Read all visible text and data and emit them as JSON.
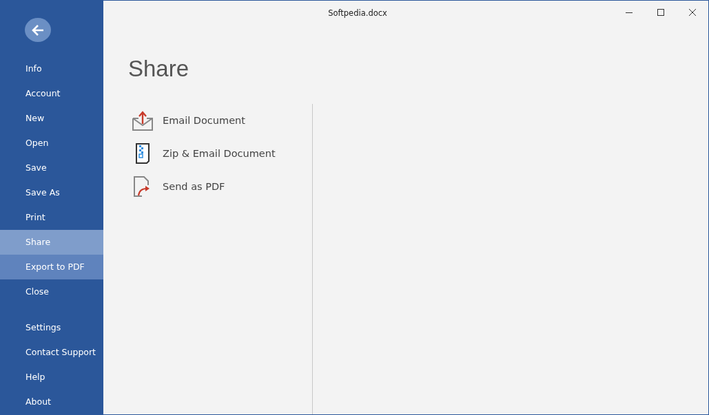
{
  "window": {
    "title": "Softpedia.docx"
  },
  "sidebar": {
    "items": [
      {
        "label": "Info",
        "selected": false,
        "hovered": false
      },
      {
        "label": "Account",
        "selected": false,
        "hovered": false
      },
      {
        "label": "New",
        "selected": false,
        "hovered": false
      },
      {
        "label": "Open",
        "selected": false,
        "hovered": false
      },
      {
        "label": "Save",
        "selected": false,
        "hovered": false
      },
      {
        "label": "Save As",
        "selected": false,
        "hovered": false
      },
      {
        "label": "Print",
        "selected": false,
        "hovered": false
      },
      {
        "label": "Share",
        "selected": true,
        "hovered": false
      },
      {
        "label": "Export to PDF",
        "selected": false,
        "hovered": true
      },
      {
        "label": "Close",
        "selected": false,
        "hovered": false
      }
    ],
    "bottom_items": [
      {
        "label": "Settings",
        "selected": false,
        "hovered": false
      },
      {
        "label": "Contact Support",
        "selected": false,
        "hovered": false
      },
      {
        "label": "Help",
        "selected": false,
        "hovered": false
      },
      {
        "label": "About",
        "selected": false,
        "hovered": false
      }
    ]
  },
  "page": {
    "heading": "Share",
    "options": [
      {
        "kind": "email",
        "label": "Email Document"
      },
      {
        "kind": "zip",
        "label": "Zip & Email Document"
      },
      {
        "kind": "pdf",
        "label": "Send as PDF"
      }
    ]
  }
}
